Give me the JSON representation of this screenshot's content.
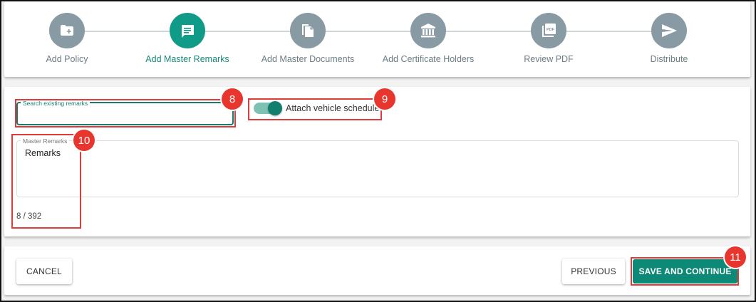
{
  "stepper": {
    "steps": [
      {
        "label": "Add Policy",
        "icon": "folder-plus-icon",
        "active": false
      },
      {
        "label": "Add Master Remarks",
        "icon": "comment-icon",
        "active": true
      },
      {
        "label": "Add Master Documents",
        "icon": "documents-icon",
        "active": false
      },
      {
        "label": "Add Certificate Holders",
        "icon": "bank-icon",
        "active": false
      },
      {
        "label": "Review PDF",
        "icon": "pdf-icon",
        "active": false
      },
      {
        "label": "Distribute",
        "icon": "send-icon",
        "active": false
      }
    ]
  },
  "remarks_form": {
    "search_label": "Search existing remarks",
    "search_value": "",
    "toggle_label": "Attach vehicle schedule",
    "toggle_on": true,
    "master_remarks_label": "Master Remarks",
    "master_remarks_value": "Remarks",
    "counter": "8 / 392"
  },
  "actions": {
    "cancel_label": "CANCEL",
    "previous_label": "PREVIOUS",
    "save_label": "SAVE AND CONTINUE"
  },
  "annotations": [
    {
      "number": "8"
    },
    {
      "number": "9"
    },
    {
      "number": "10"
    },
    {
      "number": "11"
    }
  ],
  "colors": {
    "accent": "#0f9b87",
    "inactive_step": "#889aa3",
    "annotation": "#e03a3a"
  }
}
